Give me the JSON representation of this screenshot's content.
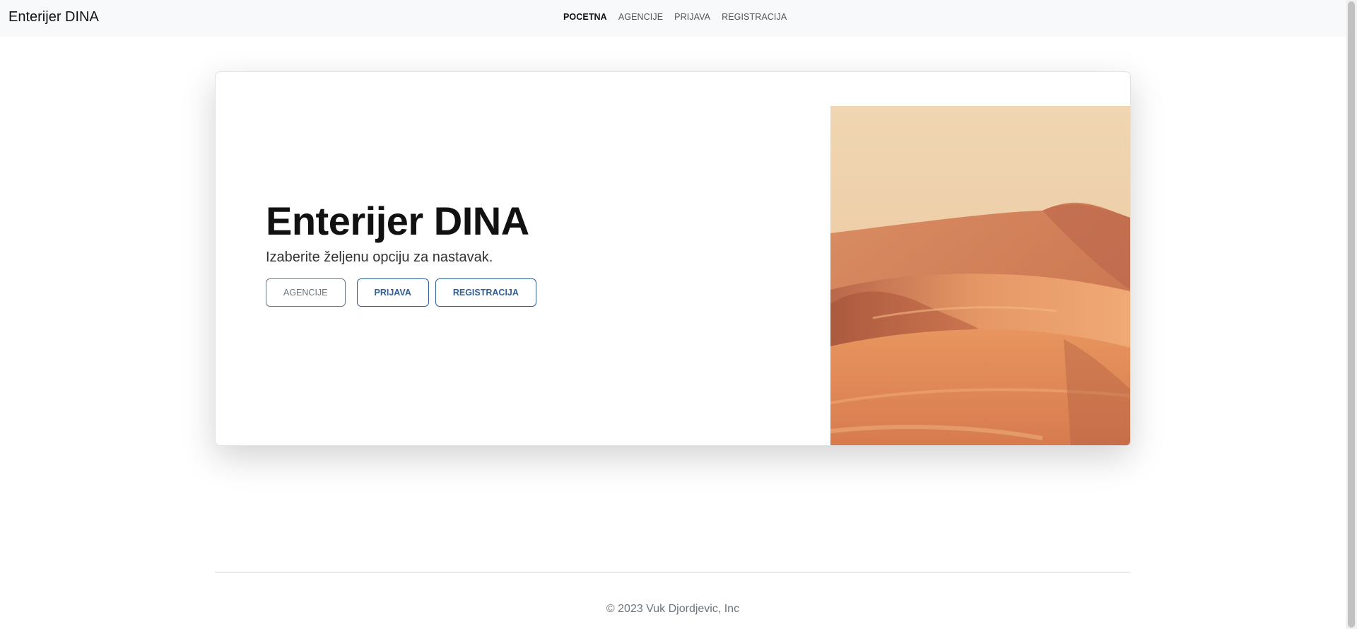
{
  "navbar": {
    "brand": "Enterijer DINA",
    "links": [
      {
        "label": "POCETNA",
        "active": true
      },
      {
        "label": "AGENCIJE",
        "active": false
      },
      {
        "label": "PRIJAVA",
        "active": false
      },
      {
        "label": "REGISTRACIJA",
        "active": false
      }
    ]
  },
  "hero": {
    "title": "Enterijer DINA",
    "subtitle": "Izaberite željenu opciju za nastavak.",
    "buttons": {
      "agencies": "AGENCIJE",
      "login": "PRIJAVA",
      "register": "REGISTRACIJA"
    },
    "image": "desert-dunes-image"
  },
  "footer": {
    "copyright": "© 2023 Vuk Djordjevic, Inc"
  },
  "colors": {
    "primary_outline": "#2f5f99",
    "secondary_outline": "#6c757d",
    "navbar_bg": "#f8f9fa"
  }
}
